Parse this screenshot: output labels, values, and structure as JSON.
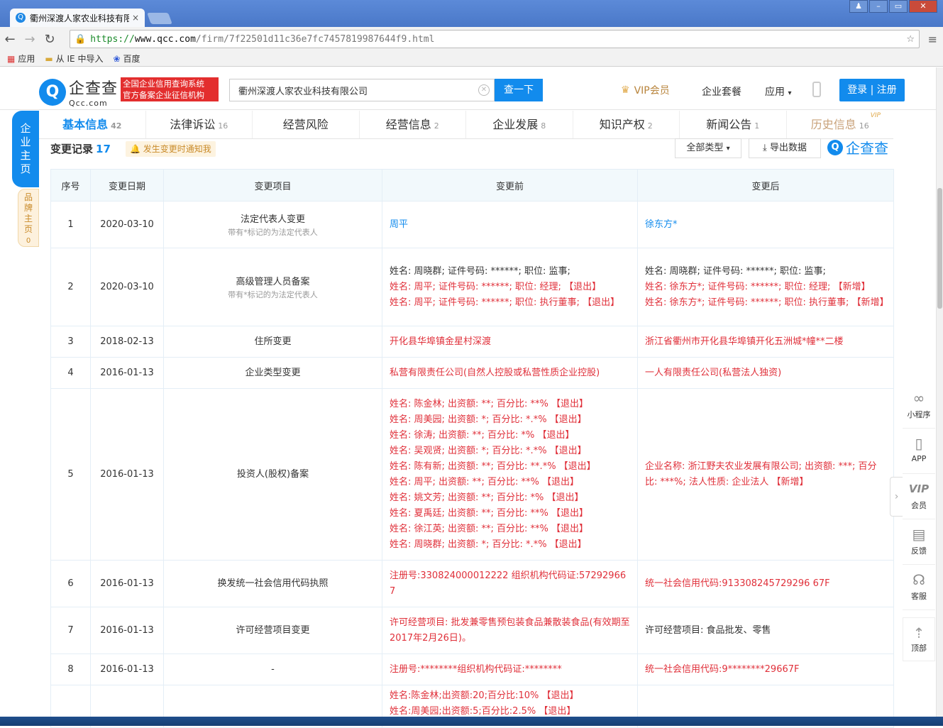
{
  "browser": {
    "tab_title": "衢州深渡人家农业科技有限",
    "url_scheme": "https://",
    "url_host": "www.qcc.com",
    "url_path": "/firm/7f22501d11c36e7fc7457819987644f9.html",
    "bookmarks": [
      "应用",
      "从 IE 中导入",
      "百度"
    ]
  },
  "header": {
    "logo_cn": "企查查",
    "logo_en": "Qcc.com",
    "slogan_line1": "全国企业信用查询系统",
    "slogan_line2": "官方备案企业征信机构",
    "search_value": "衢州深渡人家农业科技有限公司",
    "search_button": "查一下",
    "vip_label": "VIP会员",
    "package_label": "企业套餐",
    "apps_label": "应用",
    "login_label": "登录 | 注册"
  },
  "nav": {
    "tabs": [
      {
        "label": "基本信息",
        "count": "42"
      },
      {
        "label": "法律诉讼",
        "count": "16"
      },
      {
        "label": "经营风险",
        "count": ""
      },
      {
        "label": "经营信息",
        "count": "2"
      },
      {
        "label": "企业发展",
        "count": "8"
      },
      {
        "label": "知识产权",
        "count": "2"
      },
      {
        "label": "新闻公告",
        "count": "1"
      },
      {
        "label": "历史信息",
        "count": "16"
      }
    ],
    "history_vip": "VIP"
  },
  "side": {
    "main_tab": "企业主页",
    "brand_tab": "品牌主页",
    "brand_count": "0"
  },
  "section": {
    "title": "变更记录",
    "count": "17",
    "notify": "发生变更时通知我",
    "filter": "全部类型",
    "export": "导出数据",
    "watermark": "企查查"
  },
  "table": {
    "headers": [
      "序号",
      "变更日期",
      "变更项目",
      "变更前",
      "变更后"
    ],
    "rows": [
      {
        "no": "1",
        "date": "2020-03-10",
        "item": "法定代表人变更",
        "note": "带有*标记的为法定代表人"
      },
      {
        "no": "2",
        "date": "2020-03-10",
        "item": "高级管理人员备案",
        "note": "带有*标记的为法定代表人"
      },
      {
        "no": "3",
        "date": "2018-02-13",
        "item": "住所变更"
      },
      {
        "no": "4",
        "date": "2016-01-13",
        "item": "企业类型变更"
      },
      {
        "no": "5",
        "date": "2016-01-13",
        "item": "投资人(股权)备案"
      },
      {
        "no": "6",
        "date": "2016-01-13",
        "item": "换发统一社会信用代码执照"
      },
      {
        "no": "7",
        "date": "2016-01-13",
        "item": "许可经营项目变更"
      },
      {
        "no": "8",
        "date": "2016-01-13",
        "item": "-"
      }
    ],
    "r1": {
      "before": "周平",
      "after": "徐东方*"
    },
    "r2": {
      "b1": "姓名: 周晓群; 证件号码: ******; 职位: 监事;",
      "b2": "姓名: 周平; 证件号码: ******; 职位: 经理; 【退出】",
      "b3": "姓名: 周平; 证件号码: ******; 职位: 执行董事; 【退出】",
      "a1": "姓名: 周晓群; 证件号码: ******; 职位: 监事;",
      "a2": "姓名: 徐东方*; 证件号码: ******; 职位: 经理; 【新增】",
      "a3": "姓名: 徐东方*; 证件号码: ******; 职位: 执行董事; 【新增】"
    },
    "r3": {
      "before": "开化县华埠镇金星村深渡",
      "after": "浙江省衢州市开化县华埠镇开化五洲城*幢**二楼"
    },
    "r4": {
      "before": "私营有限责任公司(自然人控股或私营性质企业控股)",
      "after": "一人有限责任公司(私营法人独资)"
    },
    "r5": {
      "before": [
        "姓名: 陈金林; 出资额: **; 百分比: **% 【退出】",
        "姓名: 周美园; 出资额: *; 百分比: *.*% 【退出】",
        "姓名: 徐涛; 出资额: **; 百分比: *% 【退出】",
        "姓名: 吴观贤; 出资额: *; 百分比: *.*% 【退出】",
        "姓名: 陈有新; 出资额: **; 百分比: **.*% 【退出】",
        "姓名: 周平; 出资额: **; 百分比: **% 【退出】",
        "姓名: 姚文芳; 出资额: **; 百分比: *% 【退出】",
        "姓名: 夏禹廷; 出资额: **; 百分比: **% 【退出】",
        "姓名: 徐江英; 出资额: **; 百分比: **% 【退出】",
        "姓名: 周晓群; 出资额: *; 百分比: *.*% 【退出】"
      ],
      "after": "企业名称: 浙江野夫农业发展有限公司; 出资额: ***; 百分比: ***%; 法人性质: 企业法人 【新增】"
    },
    "r6": {
      "before": "注册号:330824000012222 组织机构代码证:572929667",
      "after": "统一社会信用代码:913308245729296 67F"
    },
    "r7": {
      "before": "许可经营项目: 批发兼零售预包装食品兼散装食品(有效期至2017年2月26日)。",
      "after": "许可经营项目: 食品批发、零售"
    },
    "r8": {
      "before": "注册号:********组织机构代码证:********",
      "after": "统一社会信用代码:9********29667F"
    },
    "r9": {
      "b1": "姓名:陈金林;出资额:20;百分比:10% 【退出】",
      "b2": "姓名:周美园;出资额:5;百分比:2.5% 【退出】"
    }
  },
  "rightbar": {
    "items": [
      "小程序",
      "APP",
      "会员",
      "反馈",
      "客服"
    ],
    "top": "顶部"
  }
}
